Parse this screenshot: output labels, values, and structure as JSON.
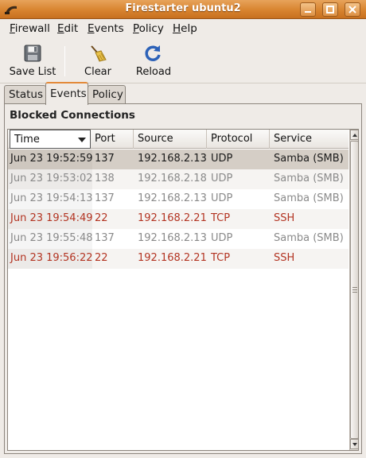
{
  "window": {
    "title": "Firestarter ubuntu2"
  },
  "menu": [
    {
      "label": "Firewall",
      "accel": "F",
      "rest": "irewall"
    },
    {
      "label": "Edit",
      "accel": "E",
      "rest": "dit"
    },
    {
      "label": "Events",
      "accel": "E",
      "rest": "vents"
    },
    {
      "label": "Policy",
      "accel": "P",
      "rest": "olicy"
    },
    {
      "label": "Help",
      "accel": "H",
      "rest": "elp"
    }
  ],
  "toolbar": {
    "save_label": "Save List",
    "clear_label": "Clear",
    "reload_label": "Reload"
  },
  "tabs": [
    {
      "label": "Status",
      "active": false
    },
    {
      "label": "Events",
      "active": true
    },
    {
      "label": "Policy",
      "active": false
    }
  ],
  "panel": {
    "title": "Blocked Connections"
  },
  "table": {
    "columns": [
      "Time",
      "Port",
      "Source",
      "Protocol",
      "Service"
    ],
    "sorted_column": "Time",
    "rows": [
      {
        "time": "Jun 23 19:52:59",
        "port": "137",
        "source": "192.168.2.13",
        "protocol": "UDP",
        "service": "Samba (SMB)",
        "style": "dark",
        "selected": true
      },
      {
        "time": "Jun 23 19:53:02",
        "port": "138",
        "source": "192.168.2.18",
        "protocol": "UDP",
        "service": "Samba (SMB)",
        "style": "gray",
        "selected": false
      },
      {
        "time": "Jun 23 19:54:13",
        "port": "137",
        "source": "192.168.2.13",
        "protocol": "UDP",
        "service": "Samba (SMB)",
        "style": "gray",
        "selected": false
      },
      {
        "time": "Jun 23 19:54:49",
        "port": "22",
        "source": "192.168.2.21",
        "protocol": "TCP",
        "service": "SSH",
        "style": "red",
        "selected": false
      },
      {
        "time": "Jun 23 19:55:48",
        "port": "137",
        "source": "192.168.2.13",
        "protocol": "UDP",
        "service": "Samba (SMB)",
        "style": "gray",
        "selected": false
      },
      {
        "time": "Jun 23 19:56:22",
        "port": "22",
        "source": "192.168.2.21",
        "protocol": "TCP",
        "service": "SSH",
        "style": "red",
        "selected": false
      }
    ]
  },
  "colors": {
    "titlebar": "#d8842f",
    "tab_accent": "#e38a3a",
    "row_red": "#b33422",
    "row_gray": "#8a8a8a",
    "selected_row": "#d5cec6"
  }
}
